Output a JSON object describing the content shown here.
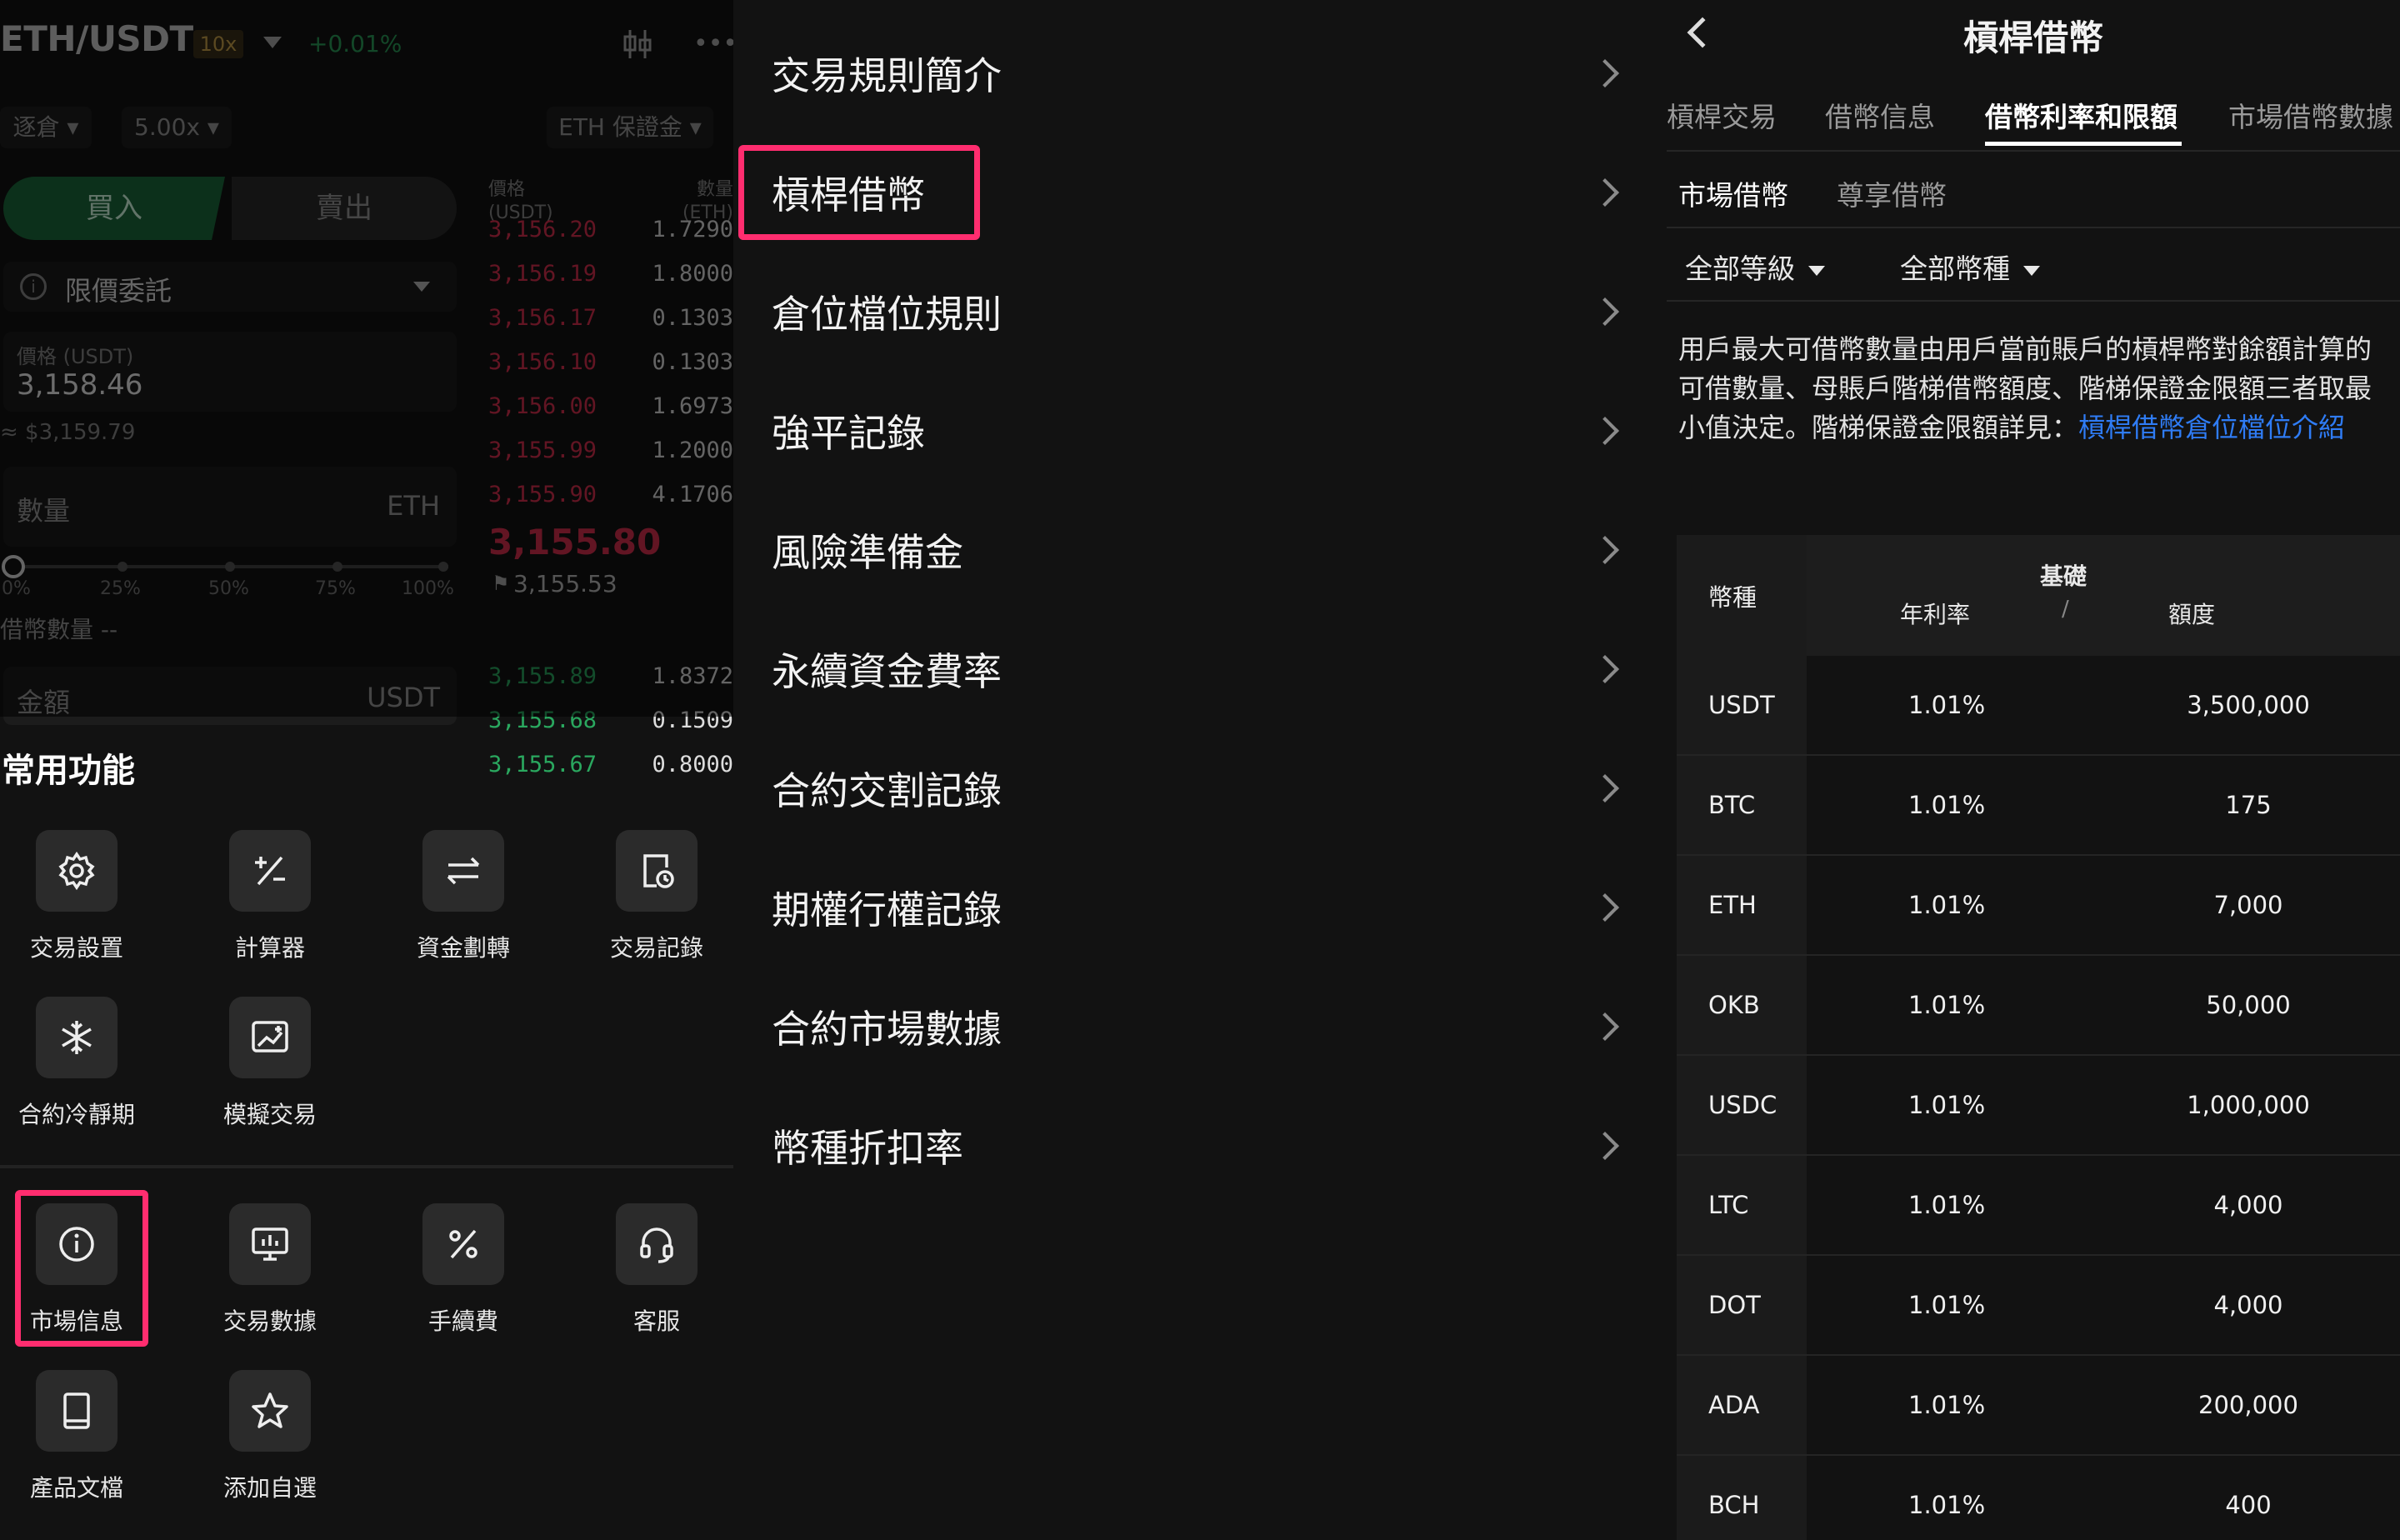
{
  "left": {
    "pair": "ETH/USDT",
    "leverage_badge": "10x",
    "change": "+0.01%",
    "margin_mode": "逐倉",
    "leverage": "5.00x",
    "margin_asset": "ETH 保證金",
    "buy_label": "買入",
    "sell_label": "賣出",
    "order_type": "限價委託",
    "price_label": "價格 (USDT)",
    "price_value": "3,158.46",
    "price_approx": "≈ $3,159.79",
    "qty_label": "數量",
    "qty_unit": "ETH",
    "slider_marks": [
      "0%",
      "25%",
      "50%",
      "75%",
      "100%"
    ],
    "borrow_label": "借幣數量 --",
    "amount_label": "金額",
    "amount_unit": "USDT",
    "ob_header_price": "價格\n(USDT)",
    "ob_header_qty": "數量\n(ETH)",
    "asks": [
      {
        "p": "3,156.20",
        "q": "1.7290"
      },
      {
        "p": "3,156.19",
        "q": "1.8000"
      },
      {
        "p": "3,156.17",
        "q": "0.1303"
      },
      {
        "p": "3,156.10",
        "q": "0.1303"
      },
      {
        "p": "3,156.00",
        "q": "1.6973"
      },
      {
        "p": "3,155.99",
        "q": "1.2000"
      },
      {
        "p": "3,155.90",
        "q": "4.1706"
      }
    ],
    "last_price": "3,155.80",
    "mark_price": "3,155.53",
    "bids": [
      {
        "p": "3,155.89",
        "q": "1.8372"
      },
      {
        "p": "3,155.68",
        "q": "0.1509"
      },
      {
        "p": "3,155.67",
        "q": "0.8000"
      }
    ],
    "section_title": "常用功能",
    "tools_row1": [
      {
        "label": "交易設置",
        "icon": "gear-icon"
      },
      {
        "label": "計算器",
        "icon": "calculator-icon"
      },
      {
        "label": "資金劃轉",
        "icon": "transfer-icon"
      },
      {
        "label": "交易記錄",
        "icon": "history-icon"
      }
    ],
    "tools_row2": [
      {
        "label": "合約冷靜期",
        "icon": "snowflake-icon"
      },
      {
        "label": "模擬交易",
        "icon": "demo-trading-icon"
      }
    ],
    "tools_row3": [
      {
        "label": "市場信息",
        "icon": "info-icon"
      },
      {
        "label": "交易數據",
        "icon": "data-icon"
      },
      {
        "label": "手續費",
        "icon": "percent-icon"
      },
      {
        "label": "客服",
        "icon": "headset-icon"
      }
    ],
    "tools_row4": [
      {
        "label": "產品文檔",
        "icon": "document-icon"
      },
      {
        "label": "添加自選",
        "icon": "star-icon"
      }
    ]
  },
  "menu": {
    "items": [
      "交易規則簡介",
      "槓桿借幣",
      "倉位檔位規則",
      "強平記錄",
      "風險準備金",
      "永續資金費率",
      "合約交割記錄",
      "期權行權記錄",
      "合約市場數據",
      "幣種折扣率"
    ]
  },
  "right": {
    "title": "槓桿借幣",
    "tabs": [
      "槓桿交易",
      "借幣信息",
      "借幣利率和限額",
      "市場借幣數據"
    ],
    "subtabs": [
      "市場借幣",
      "尊享借幣"
    ],
    "filter_level": "全部等級",
    "filter_coin": "全部幣種",
    "description": "用戶最大可借幣數量由用戶當前賬戶的槓桿幣對餘額計算的可借數量、母賬戶階梯借幣額度、階梯保證金限額三者取最小值決定。階梯保證金限額詳見：",
    "description_link": "槓桿借幣倉位檔位介紹",
    "table": {
      "col_coin": "幣種",
      "group": "基礎",
      "col_rate": "年利率",
      "slash": "/",
      "col_limit": "額度",
      "rows": [
        {
          "coin": "USDT",
          "rate": "1.01%",
          "limit": "3,500,000"
        },
        {
          "coin": "BTC",
          "rate": "1.01%",
          "limit": "175"
        },
        {
          "coin": "ETH",
          "rate": "1.01%",
          "limit": "7,000"
        },
        {
          "coin": "OKB",
          "rate": "1.01%",
          "limit": "50,000"
        },
        {
          "coin": "USDC",
          "rate": "1.01%",
          "limit": "1,000,000"
        },
        {
          "coin": "LTC",
          "rate": "1.01%",
          "limit": "4,000"
        },
        {
          "coin": "DOT",
          "rate": "1.01%",
          "limit": "4,000"
        },
        {
          "coin": "ADA",
          "rate": "1.01%",
          "limit": "200,000"
        },
        {
          "coin": "BCH",
          "rate": "1.01%",
          "limit": "400"
        }
      ]
    }
  },
  "colors": {
    "accent_highlight": "#ff2d6f",
    "link": "#2f7cf5",
    "ask": "#d9304f",
    "bid": "#2aa85f"
  }
}
